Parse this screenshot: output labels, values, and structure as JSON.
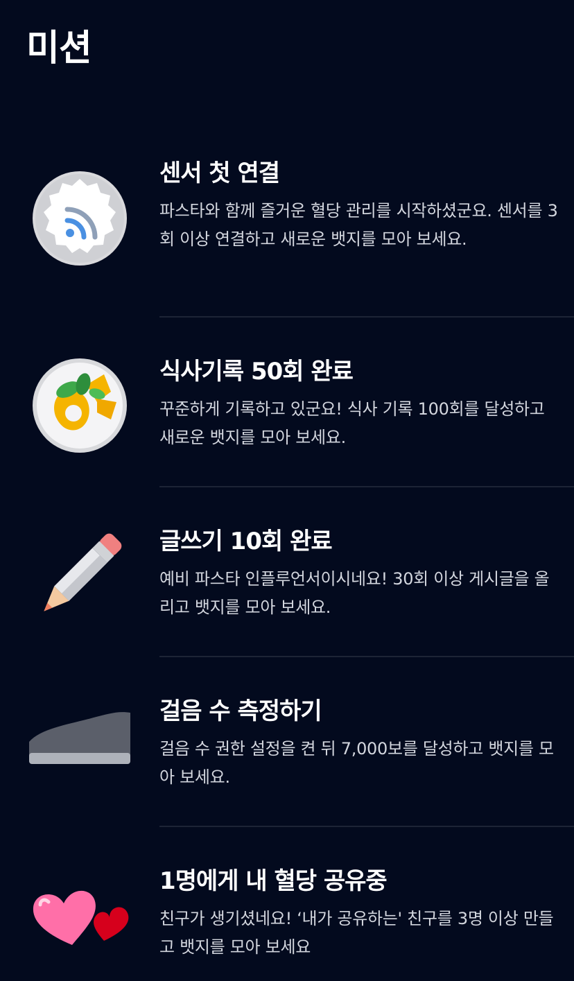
{
  "header": {
    "title": "미션"
  },
  "missions": [
    {
      "title": "센서 첫 연결",
      "description": "파스타와 함께 즐거운 혈당 관리를 시작하셨군요. 센서를 3회 이상 연결하고 새로운 뱃지를 모아 보세요.",
      "icon": "sensor-badge-icon"
    },
    {
      "title": "식사기록 50회 완료",
      "description": "꾸준하게 기록하고 있군요! 식사 기록 100회를 달성하고 새로운 뱃지를 모아 보세요.",
      "icon": "pasta-plate-icon"
    },
    {
      "title": "글쓰기 10회 완료",
      "description": "예비 파스타 인플루언서이시네요! 30회 이상 게시글을 올리고 뱃지를 모아 보세요.",
      "icon": "pencil-icon"
    },
    {
      "title": "걸음 수 측정하기",
      "description": "걸음 수 권한 설정을 켠 뒤 7,000보를 달성하고 뱃지를 모아 보세요.",
      "icon": "shoe-icon"
    },
    {
      "title": "1명에게 내 혈당 공유중",
      "description": "친구가 생기셨네요! ‘내가 공유하는' 친구를 3명 이상 만들고 뱃지를 모아 보세요",
      "icon": "hearts-icon"
    }
  ],
  "colors": {
    "background": "#030a1e",
    "divider": "#1d2436",
    "description_text": "#d3d6de"
  }
}
